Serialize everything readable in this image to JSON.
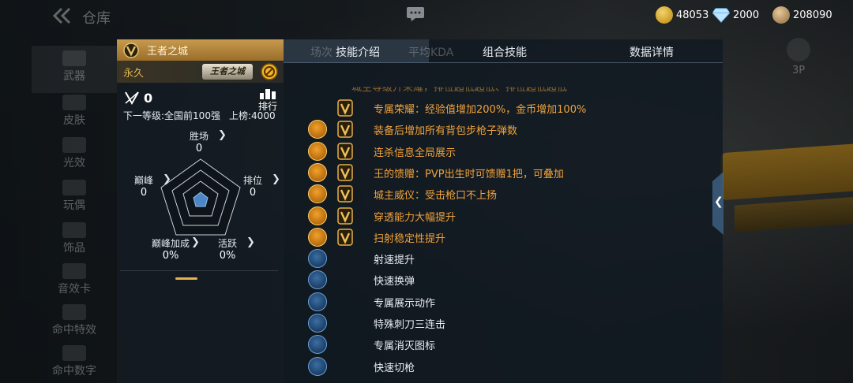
{
  "topbar": {
    "title": "仓库",
    "gold": "48053",
    "diamonds": "2000",
    "medals": "208090"
  },
  "sidebar": {
    "items": [
      {
        "label": "武器"
      },
      {
        "label": "皮肤"
      },
      {
        "label": "光效"
      },
      {
        "label": "玩偶"
      },
      {
        "label": "饰品"
      },
      {
        "label": "音效卡"
      },
      {
        "label": "命中特效"
      },
      {
        "label": "命中数字"
      }
    ]
  },
  "card": {
    "title": "王者之城",
    "duration": "永久",
    "badge_text": "王者之城",
    "rank_value": "0",
    "rank_button": "排行",
    "next_level": "下一等级:全国前100强",
    "on_board": "上榜:4000",
    "stats": {
      "wins_label": "胜场",
      "wins_value": "0",
      "peak_label": "巅峰",
      "peak_value": "0",
      "rank_label": "排位",
      "rank_value": "0",
      "peak_bonus_label": "巅峰加成",
      "peak_bonus_value": "0%",
      "active_label": "活跃",
      "active_value": "0%"
    }
  },
  "panel": {
    "tabs": {
      "t1": "技能介绍",
      "t2": "组合技能",
      "t3": "数据详情",
      "ghost1": "场次",
      "ghost2": "平均KDA"
    },
    "top_cut_text": "城主等级升荣耀，排位超低超低、排位超低超低",
    "skills": [
      {
        "text": "专属荣耀：经验值增加200%，金币增加100%",
        "tier": "gold",
        "icon": "none"
      },
      {
        "text": "装备后增加所有背包步枪子弹数",
        "tier": "gold",
        "icon": "bullet-icon"
      },
      {
        "text": "连杀信息全局展示",
        "tier": "gold",
        "icon": "killfeed-icon"
      },
      {
        "text": "王的馈赠：PVP出生时可馈赠1把，可叠加",
        "tier": "gold",
        "icon": "gift-icon"
      },
      {
        "text": "城主威仪：受击枪口不上扬",
        "tier": "gold",
        "icon": "recoil-icon"
      },
      {
        "text": "穿透能力大幅提升",
        "tier": "gold",
        "icon": "penetration-icon"
      },
      {
        "text": "扫射稳定性提升",
        "tier": "gold",
        "icon": "stability-icon"
      },
      {
        "text": "射速提升",
        "tier": "blue",
        "icon": "fire-rate-icon"
      },
      {
        "text": "快速换弹",
        "tier": "blue",
        "icon": "reload-icon"
      },
      {
        "text": "专属展示动作",
        "tier": "blue",
        "icon": "showcase-icon"
      },
      {
        "text": "特殊刺刀三连击",
        "tier": "blue",
        "icon": "bayonet-icon"
      },
      {
        "text": "专属消灭图标",
        "tier": "blue",
        "icon": "elimination-icon"
      },
      {
        "text": "快速切枪",
        "tier": "blue",
        "icon": "switch-weapon-icon"
      }
    ]
  },
  "side_buttons": {
    "view_3p": "3P"
  },
  "colors": {
    "accent_gold": "#f1a23a",
    "header_gold": "#c79a4e",
    "panel_bg": "#121a22",
    "blue_icon": "#1b3e66"
  }
}
